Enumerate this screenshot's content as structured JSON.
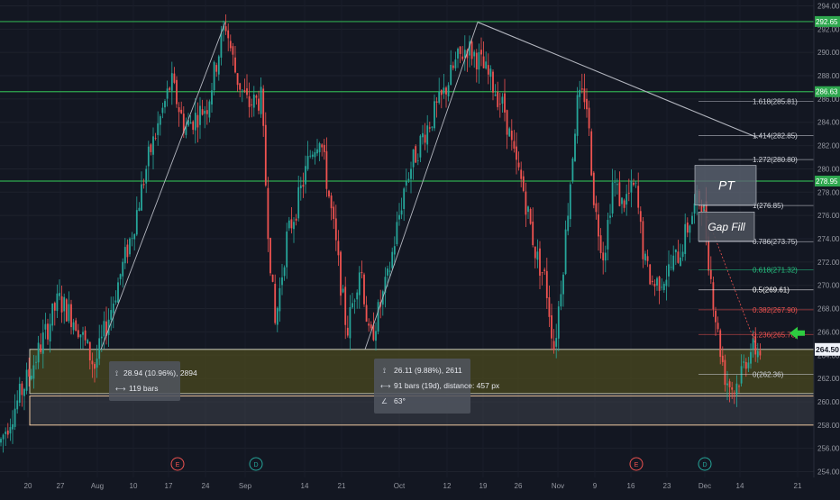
{
  "chart_data": {
    "type": "candlestick",
    "colors": {
      "up": "#26a69a",
      "down": "#ef5350",
      "background": "#131722",
      "green_level": "#2fa84f",
      "fib_line": "#9598a1",
      "last_price_bg": "#f0f3fa",
      "zone_fill": "#4b4a1f",
      "zone_border": "#c9c9b8",
      "zone2_fill": "#3a3d48",
      "zone2_border": "#f0c9a0"
    },
    "ylim": [
      253.5,
      294.5
    ],
    "y_ticks": [
      "294.00",
      "292.00",
      "290.00",
      "288.00",
      "286.00",
      "284.00",
      "282.00",
      "280.00",
      "278.00",
      "276.00",
      "274.00",
      "272.00",
      "270.00",
      "268.00",
      "266.00",
      "264.00",
      "262.00",
      "260.00",
      "258.00",
      "256.00",
      "254.00"
    ],
    "x_ticks": [
      "20",
      "27",
      "Aug",
      "10",
      "17",
      "24",
      "Sep",
      "14",
      "21",
      "Oct",
      "12",
      "19",
      "26",
      "Nov",
      "9",
      "16",
      "23",
      "Dec",
      "14",
      "21"
    ],
    "horizontal_levels": [
      {
        "label": "292.65",
        "value": 292.65
      },
      {
        "label": "286.63",
        "value": 286.63
      },
      {
        "label": "278.95",
        "value": 278.95
      }
    ],
    "last_price": {
      "label": "264.50",
      "value": 264.5
    },
    "fib_levels": [
      {
        "label": "1.618(285.81)",
        "value": 285.81,
        "color": "#d1d4dc"
      },
      {
        "label": "1.414(282.85)",
        "value": 282.85,
        "color": "#d1d4dc"
      },
      {
        "label": "1.272(280.80)",
        "value": 280.8,
        "color": "#d1d4dc"
      },
      {
        "label": "1(276.85)",
        "value": 276.85,
        "color": "#d1d4dc"
      },
      {
        "label": "0.786(273.75)",
        "value": 273.75,
        "color": "#d1d4dc"
      },
      {
        "label": "0.618(271.32)",
        "value": 271.32,
        "color": "#26c281"
      },
      {
        "label": "0.5(269.61)",
        "value": 269.61,
        "color": "#ffffff"
      },
      {
        "label": "0.382(267.90)",
        "value": 267.9,
        "color": "#ef5350"
      },
      {
        "label": "0.236(265.78)",
        "value": 265.78,
        "color": "#ef5350"
      },
      {
        "label": "0(262.36)",
        "value": 262.36,
        "color": "#d1d4dc"
      }
    ],
    "annotations": {
      "pt_label": "PT",
      "gapfill_label": "Gap Fill",
      "measure1": {
        "line1": "28.94 (10.96%), 2894",
        "line2": "119 bars"
      },
      "measure2": {
        "line1": "26.11 (9.88%), 2611",
        "line2": "91 bars (19d), distance: 457 px",
        "line3": "63°"
      }
    },
    "event_markers": [
      {
        "label": "E"
      },
      {
        "label": "D"
      },
      {
        "label": "E"
      },
      {
        "label": "D"
      }
    ],
    "anchors": [
      [
        0,
        256.5
      ],
      [
        40,
        263.8
      ],
      [
        65,
        268.8
      ],
      [
        85,
        266.8
      ],
      [
        105,
        263.0
      ],
      [
        125,
        268.5
      ],
      [
        148,
        275.0
      ],
      [
        165,
        281.0
      ],
      [
        190,
        287.5
      ],
      [
        205,
        283.5
      ],
      [
        230,
        285.5
      ],
      [
        250,
        292.6
      ],
      [
        262,
        288.0
      ],
      [
        275,
        285.5
      ],
      [
        290,
        286.0
      ],
      [
        297,
        275.5
      ],
      [
        305,
        266.5
      ],
      [
        318,
        274.0
      ],
      [
        330,
        277.0
      ],
      [
        345,
        281.5
      ],
      [
        355,
        283.0
      ],
      [
        370,
        275.0
      ],
      [
        385,
        266.0
      ],
      [
        400,
        272.0
      ],
      [
        410,
        265.0
      ],
      [
        430,
        270.5
      ],
      [
        450,
        279.0
      ],
      [
        470,
        283.0
      ],
      [
        490,
        286.0
      ],
      [
        505,
        289.0
      ],
      [
        518,
        290.5
      ],
      [
        530,
        289.5
      ],
      [
        545,
        287.5
      ],
      [
        560,
        285.0
      ],
      [
        570,
        281.0
      ],
      [
        580,
        278.5
      ],
      [
        595,
        272.5
      ],
      [
        605,
        270.5
      ],
      [
        615,
        264.5
      ],
      [
        625,
        272.0
      ],
      [
        640,
        285.5
      ],
      [
        650,
        286.5
      ],
      [
        660,
        276.5
      ],
      [
        670,
        272.5
      ],
      [
        680,
        279.0
      ],
      [
        690,
        277.0
      ],
      [
        705,
        278.5
      ],
      [
        715,
        272.0
      ],
      [
        725,
        270.0
      ],
      [
        740,
        271.0
      ],
      [
        755,
        273.0
      ],
      [
        765,
        275.5
      ],
      [
        775,
        277.5
      ],
      [
        780,
        277.0
      ],
      [
        788,
        271.0
      ],
      [
        797,
        265.5
      ],
      [
        805,
        262.0
      ],
      [
        815,
        261.0
      ],
      [
        822,
        262.5
      ],
      [
        832,
        264.5
      ],
      [
        845,
        264.5
      ]
    ]
  }
}
